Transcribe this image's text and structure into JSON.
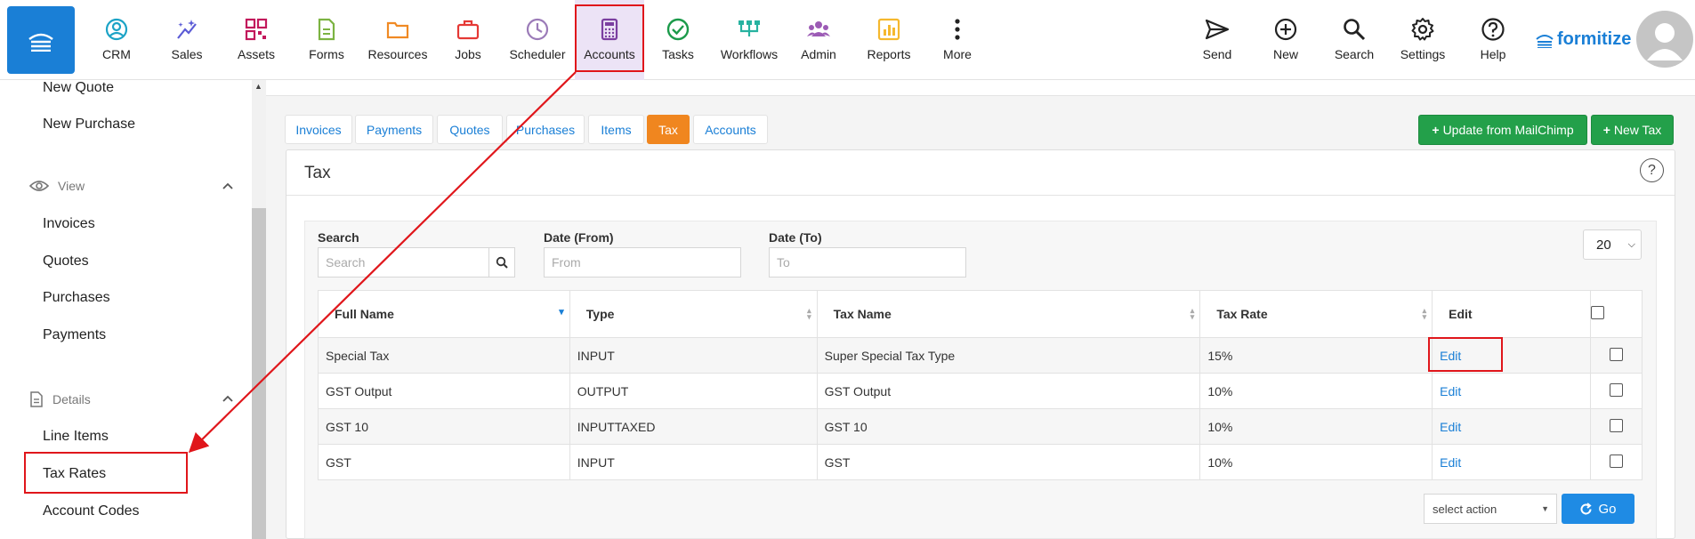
{
  "nav": {
    "items": [
      {
        "label": "CRM",
        "icon": "crm-icon"
      },
      {
        "label": "Sales",
        "icon": "sales-icon"
      },
      {
        "label": "Assets",
        "icon": "assets-icon"
      },
      {
        "label": "Forms",
        "icon": "forms-icon"
      },
      {
        "label": "Resources",
        "icon": "resources-icon"
      },
      {
        "label": "Jobs",
        "icon": "jobs-icon"
      },
      {
        "label": "Scheduler",
        "icon": "scheduler-icon"
      },
      {
        "label": "Accounts",
        "icon": "accounts-icon"
      },
      {
        "label": "Tasks",
        "icon": "tasks-icon"
      },
      {
        "label": "Workflows",
        "icon": "workflows-icon"
      },
      {
        "label": "Admin",
        "icon": "admin-icon"
      },
      {
        "label": "Reports",
        "icon": "reports-icon"
      },
      {
        "label": "More",
        "icon": "more-icon"
      }
    ],
    "right_items": [
      {
        "label": "Send",
        "icon": "send-icon"
      },
      {
        "label": "New",
        "icon": "new-icon"
      },
      {
        "label": "Search",
        "icon": "search-icon"
      },
      {
        "label": "Settings",
        "icon": "settings-icon"
      },
      {
        "label": "Help",
        "icon": "help-icon"
      }
    ],
    "brand": "formitize"
  },
  "sidebar": {
    "top_items": [
      "New Quote",
      "New Purchase"
    ],
    "view_section": "View",
    "view_items": [
      "Invoices",
      "Quotes",
      "Purchases",
      "Payments"
    ],
    "details_section": "Details",
    "details_items": [
      "Line Items",
      "Tax Rates",
      "Account Codes"
    ]
  },
  "tabs": [
    "Invoices",
    "Payments",
    "Quotes",
    "Purchases",
    "Items",
    "Tax",
    "Accounts"
  ],
  "buttons": {
    "update_mailchimp": "Update from MailChimp",
    "new_tax": "New Tax",
    "go": "Go"
  },
  "card": {
    "title": "Tax"
  },
  "filters": {
    "search_label": "Search",
    "search_placeholder": "Search",
    "date_from_label": "Date (From)",
    "date_from_placeholder": "From",
    "date_to_label": "Date (To)",
    "date_to_placeholder": "To",
    "page_size": "20"
  },
  "table": {
    "columns": [
      "Full Name",
      "Type",
      "Tax Name",
      "Tax Rate",
      "Edit"
    ],
    "rows": [
      {
        "full_name": "Special Tax",
        "type": "INPUT",
        "tax_name": "Super Special Tax Type",
        "tax_rate": "15%",
        "edit": "Edit"
      },
      {
        "full_name": "GST Output",
        "type": "OUTPUT",
        "tax_name": "GST Output",
        "tax_rate": "10%",
        "edit": "Edit"
      },
      {
        "full_name": "GST 10",
        "type": "INPUTTAXED",
        "tax_name": "GST 10",
        "tax_rate": "10%",
        "edit": "Edit"
      },
      {
        "full_name": "GST",
        "type": "INPUT",
        "tax_name": "GST",
        "tax_rate": "10%",
        "edit": "Edit"
      }
    ]
  },
  "bulk_action": {
    "placeholder": "select action"
  },
  "colors": {
    "primary": "#1a7fd6",
    "active_tab": "#f0861f",
    "green": "#23a04a",
    "highlight": "#e0161b",
    "accounts_bg": "#ece3f6"
  }
}
